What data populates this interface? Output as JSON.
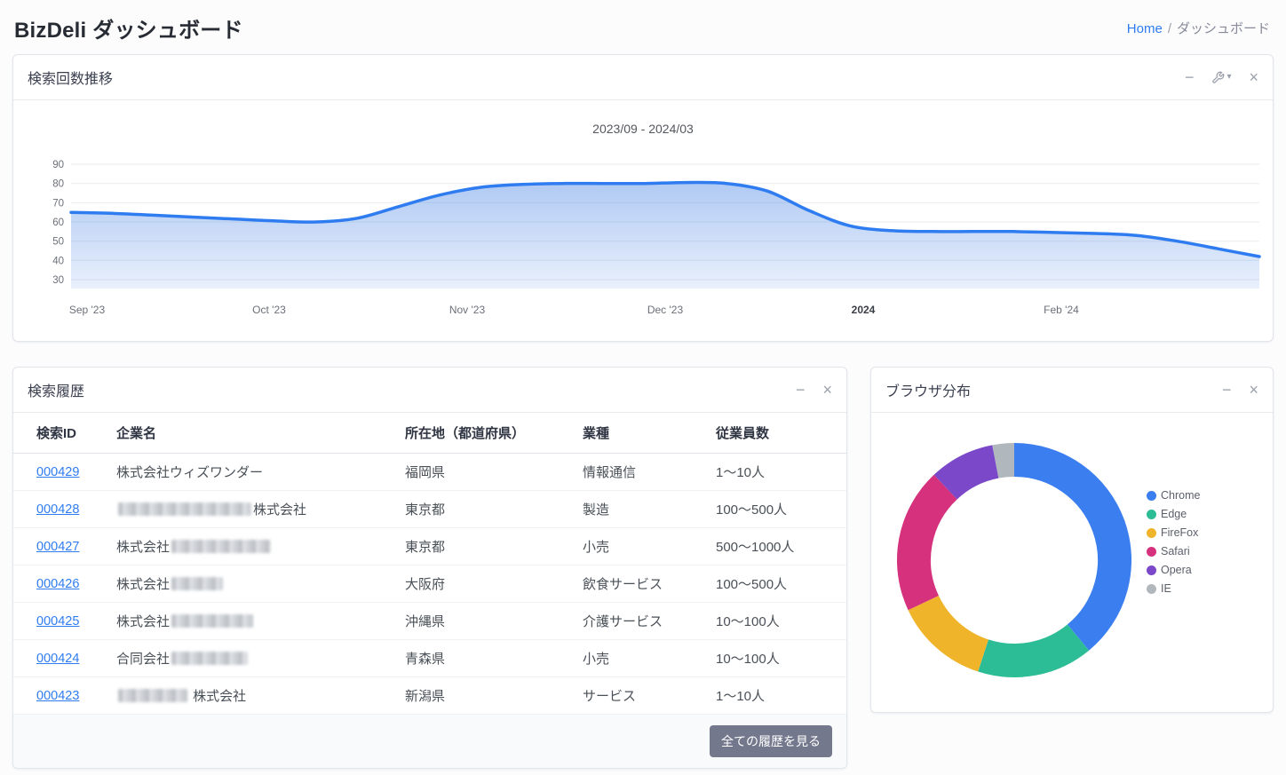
{
  "page": {
    "title": "BizDeli ダッシュボード",
    "breadcrumb": {
      "home": "Home",
      "separator": "/",
      "current": "ダッシュボード"
    }
  },
  "icons": {
    "minimize": "−",
    "close": "×",
    "caret": "▾"
  },
  "panels": {
    "search_trend": {
      "title": "検索回数推移"
    },
    "history": {
      "title": "検索履歴",
      "footer_button": "全ての履歴を見る",
      "table": {
        "headers": [
          "検索ID",
          "企業名",
          "所在地（都道府県）",
          "業種",
          "従業員数"
        ],
        "rows": [
          {
            "id": "000429",
            "company": {
              "prefix": "株式会社ウィズワンダー",
              "blur_width": 0,
              "suffix": ""
            },
            "location": "福岡県",
            "industry": "情報通信",
            "employees": "1〜10人"
          },
          {
            "id": "000428",
            "company": {
              "prefix": "",
              "blur_width": 150,
              "suffix": "株式会社"
            },
            "location": "東京都",
            "industry": "製造",
            "employees": "100〜500人"
          },
          {
            "id": "000427",
            "company": {
              "prefix": "株式会社",
              "blur_width": 112,
              "suffix": ""
            },
            "location": "東京都",
            "industry": "小売",
            "employees": "500〜1000人"
          },
          {
            "id": "000426",
            "company": {
              "prefix": "株式会社",
              "blur_width": 58,
              "suffix": ""
            },
            "location": "大阪府",
            "industry": "飲食サービス",
            "employees": "100〜500人"
          },
          {
            "id": "000425",
            "company": {
              "prefix": "株式会社",
              "blur_width": 92,
              "suffix": ""
            },
            "location": "沖縄県",
            "industry": "介護サービス",
            "employees": "10〜100人"
          },
          {
            "id": "000424",
            "company": {
              "prefix": "合同会社",
              "blur_width": 86,
              "suffix": ""
            },
            "location": "青森県",
            "industry": "小売",
            "employees": "10〜100人"
          },
          {
            "id": "000423",
            "company": {
              "prefix": "",
              "blur_width": 78,
              "suffix": " 株式会社"
            },
            "location": "新潟県",
            "industry": "サービス",
            "employees": "1〜10人"
          }
        ]
      }
    },
    "browser": {
      "title": "ブラウザ分布"
    }
  },
  "chart_data": [
    {
      "type": "area",
      "title": "2023/09 - 2024/03",
      "xlabel": "",
      "ylabel": "",
      "x_tick_labels": [
        "Sep '23",
        "Oct '23",
        "Nov '23",
        "Dec '23",
        "2024",
        "Feb '24"
      ],
      "x_tick_positions": [
        0,
        0.1667,
        0.3333,
        0.5,
        0.6667,
        0.8333
      ],
      "bold_tick": "2024",
      "y_ticks": [
        30,
        40,
        50,
        60,
        70,
        80,
        90
      ],
      "ylim": [
        30,
        90
      ],
      "grid": true,
      "line_color": "#2e7cf0",
      "fill_color": "#6f9eea",
      "series": [
        {
          "name": "検索回数",
          "values": [
            65,
            64.5,
            63.5,
            62.5,
            61.5,
            60.5,
            60,
            62,
            68,
            74,
            78,
            79.5,
            80,
            80,
            80,
            80.5,
            80,
            76,
            66,
            58,
            55.5,
            55,
            55,
            55,
            54.5,
            54,
            53,
            50,
            46,
            42
          ]
        }
      ]
    },
    {
      "type": "donut",
      "title": "ブラウザ分布",
      "labels": [
        "Chrome",
        "Edge",
        "FireFox",
        "Safari",
        "Opera",
        "IE"
      ],
      "values": [
        39,
        16,
        13,
        20,
        9,
        3
      ],
      "colors": [
        "#3b7ef0",
        "#2dbd96",
        "#f0b42a",
        "#d5317d",
        "#7a48c9",
        "#b0b7bd"
      ],
      "legend_position": "right"
    }
  ]
}
